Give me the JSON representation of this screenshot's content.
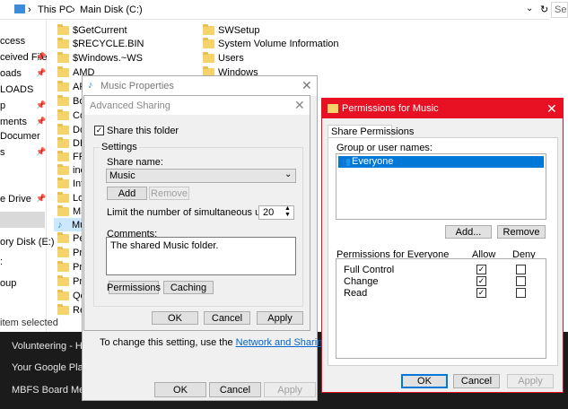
{
  "explorer": {
    "breadcrumb": [
      "This PC",
      "Main Disk (C:)"
    ],
    "search_placeholder": "Se",
    "nav_items": [
      "ccess",
      "ceived File",
      "oads",
      "LOADS",
      "p",
      "ments",
      "Documer",
      "s",
      "e Drive",
      "ory Disk (E:)",
      ":",
      "oup"
    ],
    "status": "item selected",
    "col1": [
      "$GetCurrent",
      "$RECYCLE.BIN",
      "$Windows.~WS",
      "AMD",
      "AP",
      "Bo",
      "Co",
      "Do",
      "DR",
      "FR",
      "ine",
      "Int",
      "Lo",
      "MS",
      "Mu",
      "Pe",
      "Pro",
      "Pro",
      "Pro",
      "Qo",
      "Re"
    ],
    "col2": [
      "SWSetup",
      "System Volume Information",
      "Users",
      "Windows"
    ]
  },
  "taskbar_items": [
    "Volunteering - Hi H",
    "Your Google Play",
    "MBFS Board Mee"
  ],
  "music_properties": {
    "title": "Music Properties",
    "footer_text_prefix": "To change this setting, use the ",
    "footer_link": "Network and Sharing Center",
    "footer_text_suffix": ".",
    "ok": "OK",
    "cancel": "Cancel",
    "apply": "Apply"
  },
  "advanced_sharing": {
    "title": "Advanced Sharing",
    "share_checkbox": "Share this folder",
    "share_checked": true,
    "settings_group": "Settings",
    "share_name_label": "Share name:",
    "share_name_value": "Music",
    "add": "Add",
    "remove": "Remove",
    "limit_label": "Limit the number of simultaneous users to:",
    "limit_value": "20",
    "comments_label": "Comments:",
    "comments_value": "The shared Music folder.",
    "permissions": "Permissions",
    "caching": "Caching",
    "ok": "OK",
    "cancel": "Cancel",
    "apply": "Apply"
  },
  "permissions": {
    "title": "Permissions for Music",
    "tab": "Share Permissions",
    "group_label": "Group or user names:",
    "users": [
      "Everyone"
    ],
    "add": "Add...",
    "remove": "Remove",
    "perm_label": "Permissions for Everyone",
    "allow": "Allow",
    "deny": "Deny",
    "rows": [
      {
        "name": "Full Control",
        "allow": true,
        "deny": false
      },
      {
        "name": "Change",
        "allow": true,
        "deny": false
      },
      {
        "name": "Read",
        "allow": true,
        "deny": false
      }
    ],
    "ok": "OK",
    "cancel": "Cancel",
    "apply": "Apply"
  },
  "colors": {
    "accent": "#0078d7",
    "titlebar_red": "#e81123",
    "selection": "#cce8ff"
  }
}
